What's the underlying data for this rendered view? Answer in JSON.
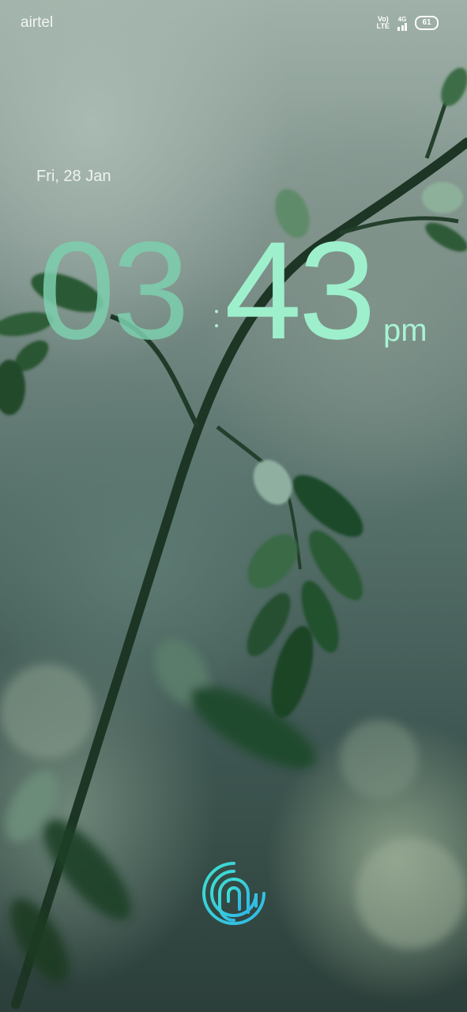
{
  "status_bar": {
    "carrier": "airtel",
    "volte_top": "Vo)",
    "volte_bottom": "LTE",
    "network_type": "4G",
    "battery_level": "61"
  },
  "lock_screen": {
    "date": "Fri, 28 Jan",
    "hours": "03",
    "minutes": "43",
    "ampm": "pm"
  },
  "icons": {
    "signal": "signal-bars-icon",
    "battery": "battery-icon",
    "fingerprint": "fingerprint-icon"
  },
  "colors": {
    "clock_hours": "#7dcfae",
    "clock_minutes": "#9ef0cc",
    "fingerprint": "#3fe0d0"
  }
}
